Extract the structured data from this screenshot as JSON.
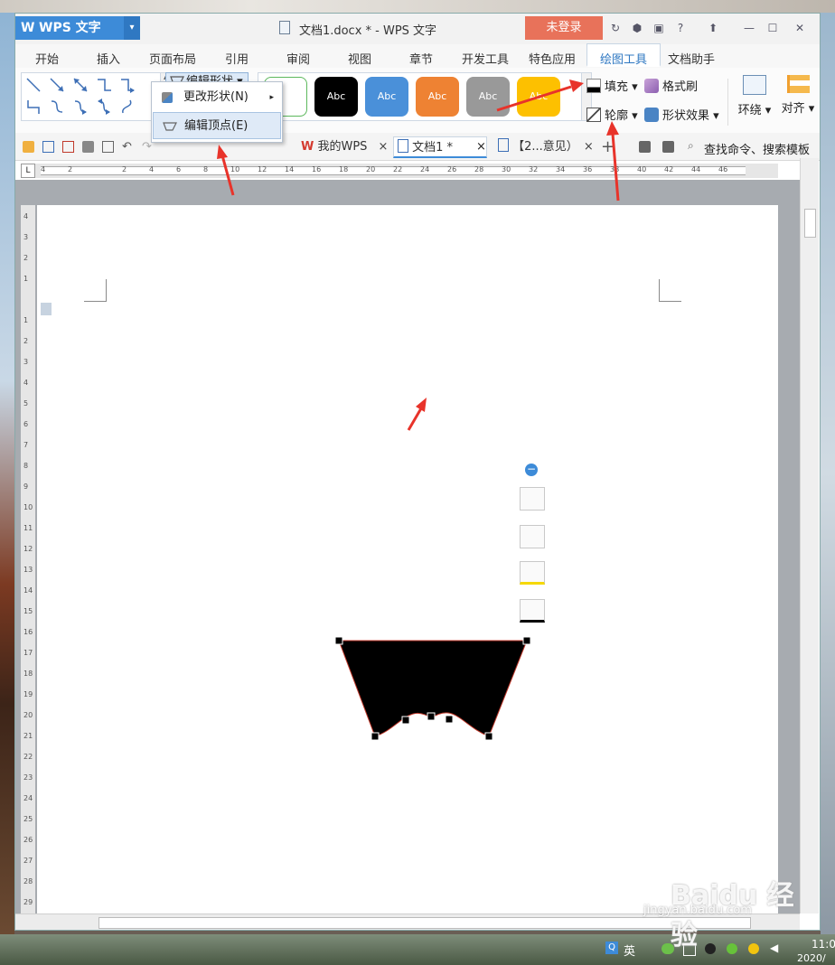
{
  "window": {
    "app_name": "WPS 文字",
    "title": "文档1.docx * - WPS 文字",
    "login_label": "未登录"
  },
  "menu": {
    "tabs": [
      "开始",
      "插入",
      "页面布局",
      "引用",
      "审阅",
      "视图",
      "章节",
      "开发工具",
      "特色应用",
      "绘图工具",
      "文档助手"
    ],
    "active": "绘图工具"
  },
  "ribbon": {
    "edit_shape_label": "编辑形状",
    "style_swatches": [
      {
        "label": "Abc",
        "color": "#ffffff",
        "border": "#5cb85c"
      },
      {
        "label": "Abc",
        "color": "#000000",
        "border": "#000000"
      },
      {
        "label": "Abc",
        "color": "#4a90d9",
        "border": "#3c7dc2"
      },
      {
        "label": "Abc",
        "color": "#ee8233",
        "border": "#d96f20"
      },
      {
        "label": "Abc",
        "color": "#999999",
        "border": "#888888"
      },
      {
        "label": "Abc",
        "color": "#fdc000",
        "border": "#e0aa00"
      }
    ],
    "fill_label": "填充",
    "format_painter_label": "格式刷",
    "outline_label": "轮廓",
    "shape_effect_label": "形状效果",
    "wrap_label": "环绕",
    "align_label": "对齐"
  },
  "dropdown": {
    "change_shape_label": "更改形状(N)",
    "edit_vertex_label": "编辑顶点(E)"
  },
  "doc_tabs": {
    "my_wps": "我的WPS",
    "doc1": "文档1 *",
    "doc2": "【2...意见）"
  },
  "search": {
    "label": "查找命令、搜索模板"
  },
  "ruler": {
    "h_ticks": [
      "4",
      "2",
      "",
      "2",
      "4",
      "6",
      "8",
      "10",
      "12",
      "14",
      "16",
      "18",
      "20",
      "22",
      "24",
      "26",
      "28",
      "30",
      "32",
      "34",
      "36",
      "38",
      "40",
      "42",
      "44",
      "46"
    ],
    "v_ticks": [
      "4",
      "3",
      "2",
      "1",
      "",
      "1",
      "2",
      "3",
      "4",
      "5",
      "6",
      "7",
      "8",
      "9",
      "10",
      "11",
      "12",
      "13",
      "14",
      "15",
      "16",
      "17",
      "18",
      "19",
      "20",
      "21",
      "22",
      "23",
      "24",
      "25",
      "26",
      "27",
      "28",
      "29"
    ]
  },
  "taskbar": {
    "ime_label": "英",
    "time": "11:0",
    "date": "2020/"
  },
  "watermark": {
    "brand": "Baidu 经验",
    "site": "jingyan.baidu.com"
  },
  "colors": {
    "accent": "#3d8bd8",
    "login": "#e8725a",
    "annotation_arrow": "#e8332a",
    "shape_fill": "#000000",
    "shape_outline": "#c0392b"
  }
}
